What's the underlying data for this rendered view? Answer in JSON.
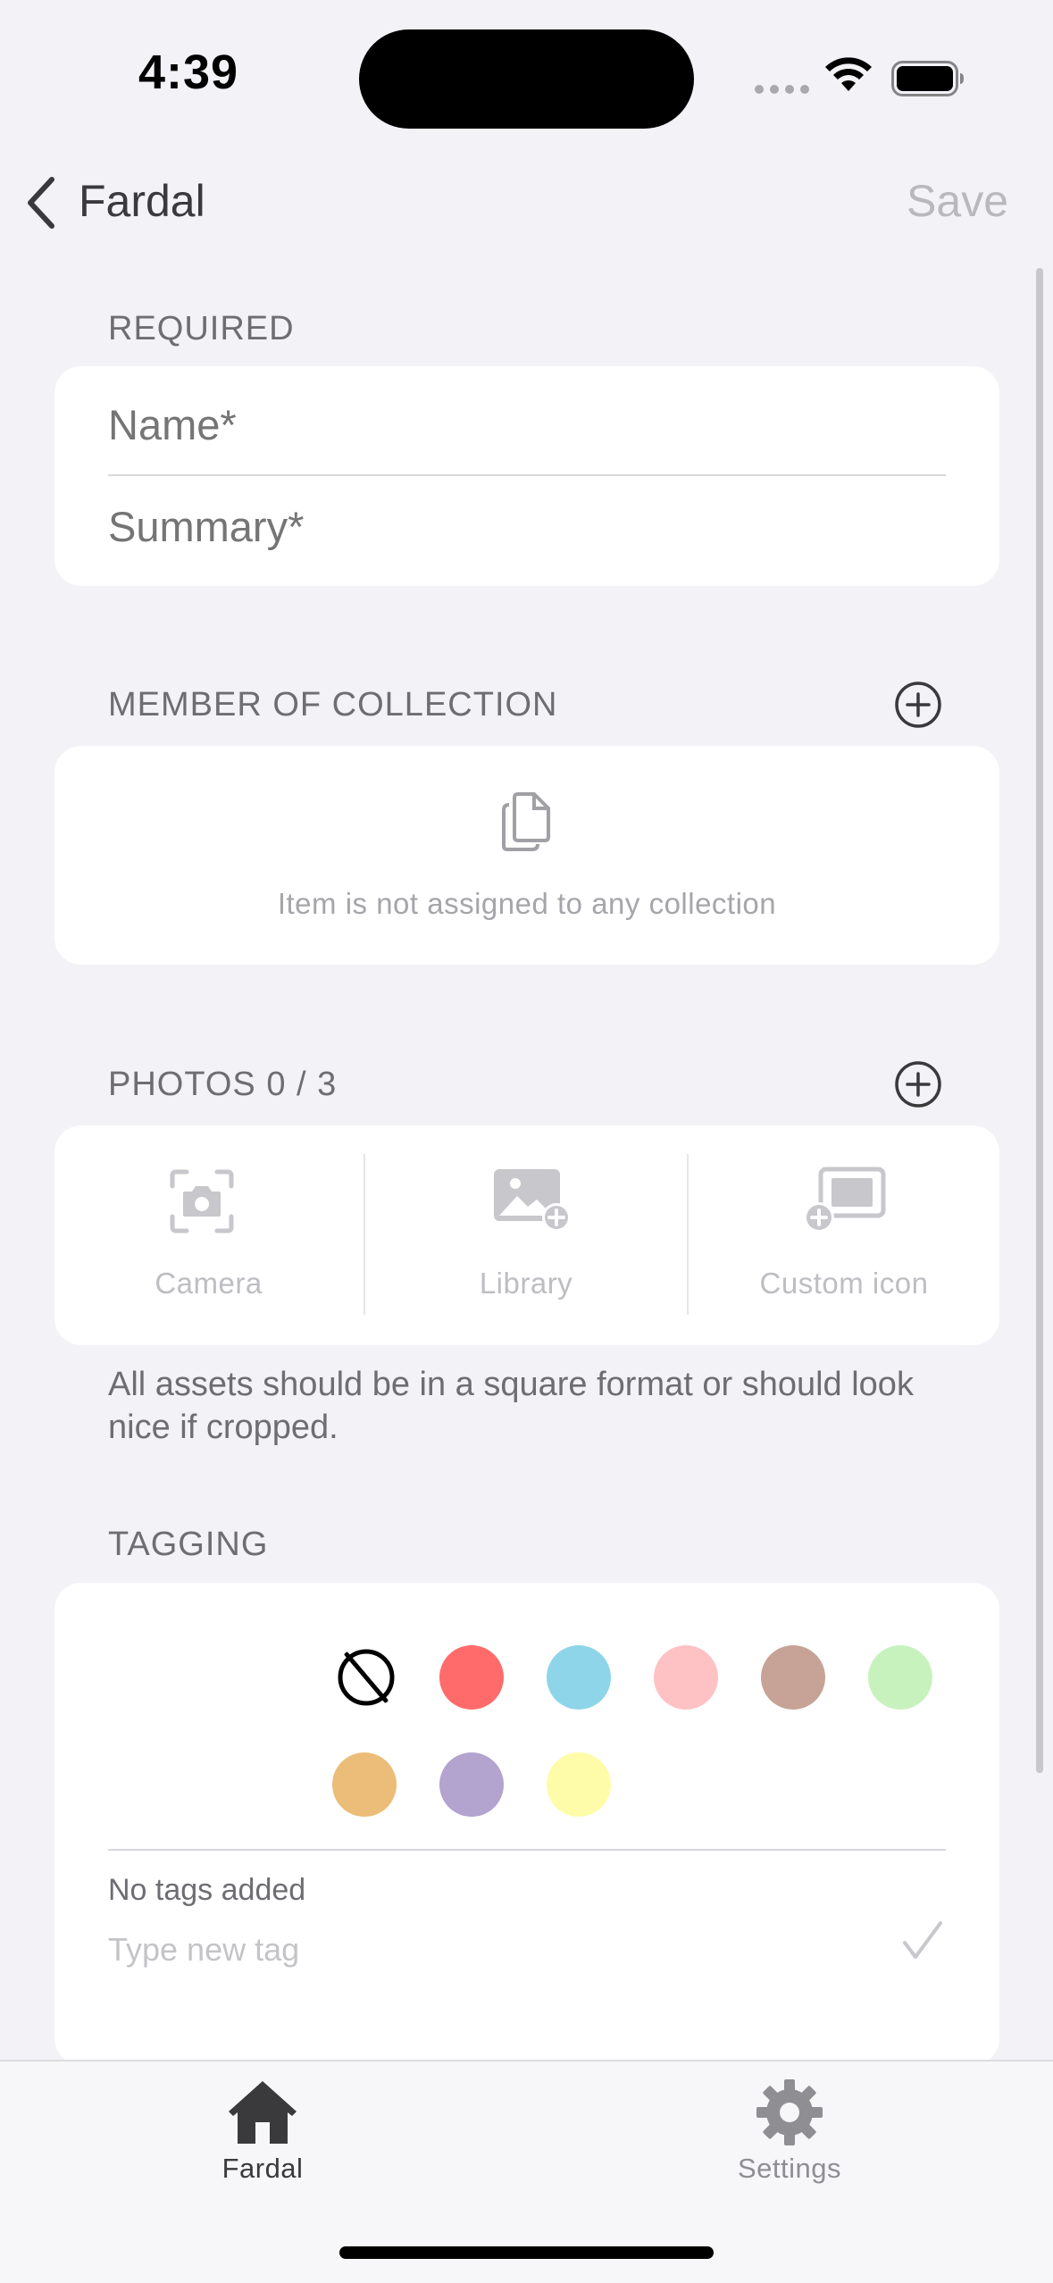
{
  "status_bar": {
    "time": "4:39"
  },
  "nav": {
    "back_title": "Fardal",
    "save_label": "Save"
  },
  "sections": {
    "required": {
      "header": "REQUIRED",
      "name_placeholder": "Name*",
      "summary_placeholder": "Summary*"
    },
    "collection": {
      "header": "MEMBER OF COLLECTION",
      "empty_text": "Item is not assigned to any collection"
    },
    "photos": {
      "header": "PHOTOS 0 / 3",
      "options": [
        {
          "label": "Camera",
          "icon": "camera-icon"
        },
        {
          "label": "Library",
          "icon": "photo-library-icon"
        },
        {
          "label": "Custom icon",
          "icon": "custom-icon-icon"
        }
      ],
      "note": "All assets should be in a square format or should look nice if cropped."
    },
    "tagging": {
      "header": "TAGGING",
      "colors": [
        "#ff6b6b",
        "#8fd5ea",
        "#ffc2c4",
        "#c6a396",
        "#c8f2bd",
        "#ecbd78",
        "#b2a3cf",
        "#fffca9"
      ],
      "no_tags_text": "No tags added",
      "new_tag_placeholder": "Type new tag"
    }
  },
  "tabbar": {
    "tabs": [
      {
        "label": "Fardal",
        "icon": "house-icon",
        "active": true
      },
      {
        "label": "Settings",
        "icon": "gear-icon",
        "active": false
      }
    ]
  }
}
